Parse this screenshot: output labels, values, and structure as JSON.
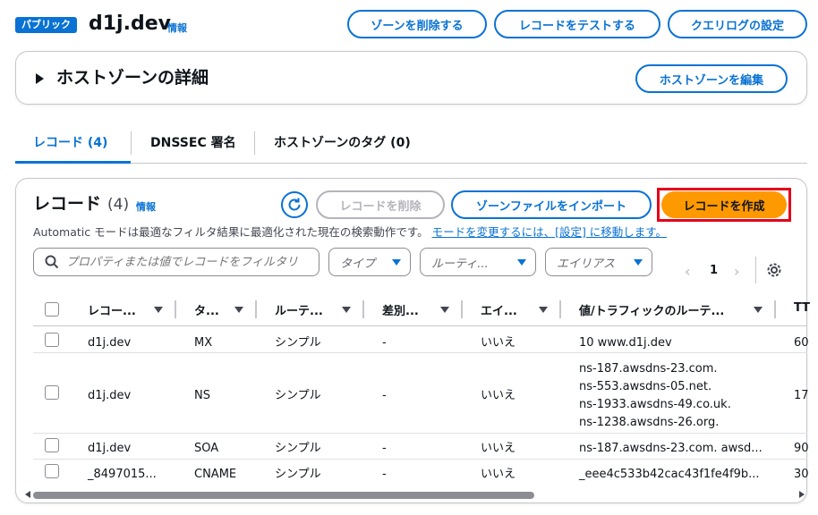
{
  "header": {
    "badge": "パブリック",
    "zone_name": "d1j.dev",
    "info": "情報",
    "buttons": {
      "delete_zone": "ゾーンを削除する",
      "test_record": "レコードをテストする",
      "query_log": "クエリログの設定"
    }
  },
  "details": {
    "title": "ホストゾーンの詳細",
    "edit_button": "ホストゾーンを編集"
  },
  "tabs": [
    {
      "label": "レコード (4)",
      "active": true
    },
    {
      "label": "DNSSEC 署名",
      "active": false
    },
    {
      "label": "ホストゾーンのタグ (0)",
      "active": false
    }
  ],
  "records": {
    "title": "レコード",
    "count": "(4)",
    "info": "情報",
    "buttons": {
      "delete": "レコードを削除",
      "import": "ゾーンファイルをインポート",
      "create": "レコードを作成"
    },
    "description": "Automatic モードは最適なフィルタ結果に最適化された現在の検索動作です。",
    "description_link": "モードを変更するには、[設定] に移動します。",
    "search_placeholder": "プロパティまたは値でレコードをフィルタリング",
    "filters": {
      "type": "タイプ",
      "routing": "ルーティ...",
      "alias": "エイリアス"
    },
    "pager": {
      "page": "1",
      "prev": "‹",
      "next": "›"
    },
    "columns": [
      "レコー...",
      "タ...",
      "ルーテ...",
      "差別...",
      "エイ...",
      "値/トラフィックのルーテ...",
      "TT"
    ],
    "rows": [
      {
        "name": "d1j.dev",
        "type": "MX",
        "routing": "シンプル",
        "diff": "-",
        "alias": "いいえ",
        "values": [
          "10 www.d1j.dev"
        ],
        "ttl": "60"
      },
      {
        "name": "d1j.dev",
        "type": "NS",
        "routing": "シンプル",
        "diff": "-",
        "alias": "いいえ",
        "values": [
          "ns-187.awsdns-23.com.",
          "ns-553.awsdns-05.net.",
          "ns-1933.awsdns-49.co.uk.",
          "ns-1238.awsdns-26.org."
        ],
        "ttl": "17"
      },
      {
        "name": "d1j.dev",
        "type": "SOA",
        "routing": "シンプル",
        "diff": "-",
        "alias": "いいえ",
        "values": [
          "ns-187.awsdns-23.com. awsd..."
        ],
        "ttl": "90"
      },
      {
        "name": "_8497015...",
        "type": "CNAME",
        "routing": "シンプル",
        "diff": "-",
        "alias": "いいえ",
        "values": [
          "_eee4c533b42cac43f1fe4f9b..."
        ],
        "ttl": "30"
      }
    ]
  },
  "colors": {
    "accent": "#0972d3",
    "primary": "#ff9900",
    "highlight": "#e3001b",
    "disabled": "#b4b4bb"
  }
}
